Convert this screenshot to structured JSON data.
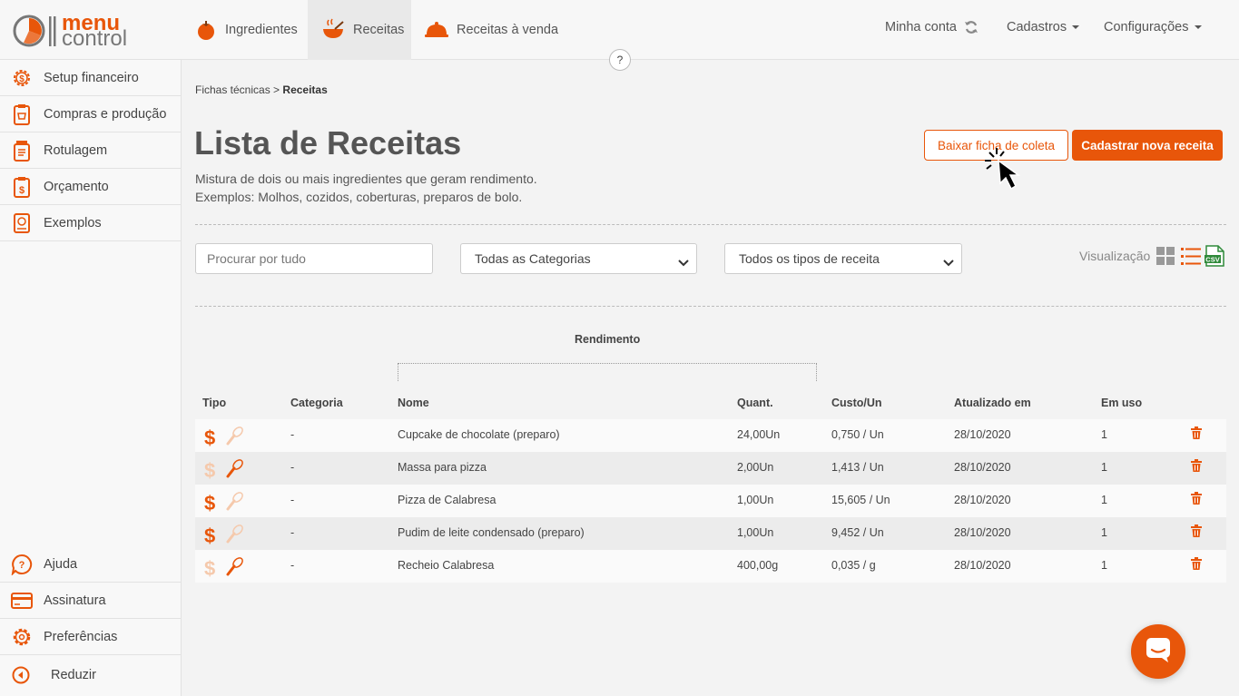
{
  "logo": {
    "line1": "menu",
    "line2": "control"
  },
  "nav": {
    "tabs": [
      {
        "label": "Ingredientes",
        "icon": "tomato-icon"
      },
      {
        "label": "Receitas",
        "icon": "bowl-icon"
      },
      {
        "label": "Receitas à venda",
        "icon": "cloche-icon"
      }
    ],
    "account": "Minha conta",
    "cadastros": "Cadastros",
    "config": "Configurações",
    "help": "?"
  },
  "sidebar": {
    "items": [
      {
        "label": "Setup financeiro"
      },
      {
        "label": "Compras e produção"
      },
      {
        "label": "Rotulagem"
      },
      {
        "label": "Orçamento"
      },
      {
        "label": "Exemplos"
      }
    ],
    "bottom": [
      {
        "label": "Ajuda"
      },
      {
        "label": "Assinatura"
      },
      {
        "label": "Preferências"
      },
      {
        "label": "Reduzir"
      }
    ]
  },
  "breadcrumb": {
    "parent": "Fichas técnicas",
    "sep": ">",
    "current": "Receitas"
  },
  "page": {
    "title": "Lista de Receitas",
    "desc1": "Mistura de dois ou mais ingredientes que geram rendimento.",
    "desc2": "Exemplos: Molhos, cozidos, coberturas, preparos de bolo."
  },
  "buttons": {
    "download": "Baixar ficha de coleta",
    "new": "Cadastrar nova receita"
  },
  "filters": {
    "search_placeholder": "Procurar por tudo",
    "category": "Todas as Categorias",
    "type": "Todos os tipos de receita",
    "view_label": "Visualização",
    "csv": "CSV"
  },
  "table": {
    "group_header": "Rendimento",
    "headers": [
      "Tipo",
      "Categoria",
      "Nome",
      "Quant.",
      "Custo/Un",
      "Atualizado em",
      "Em uso"
    ],
    "rows": [
      {
        "dollar_active": true,
        "whisk_active": false,
        "categoria": "-",
        "nome": "Cupcake de chocolate (preparo)",
        "quant": "24,00Un",
        "custo": "0,750 / Un",
        "data": "28/10/2020",
        "uso": "1"
      },
      {
        "dollar_active": false,
        "whisk_active": true,
        "categoria": "-",
        "nome": "Massa para pizza",
        "quant": "2,00Un",
        "custo": "1,413 / Un",
        "data": "28/10/2020",
        "uso": "1"
      },
      {
        "dollar_active": true,
        "whisk_active": false,
        "categoria": "-",
        "nome": "Pizza de Calabresa",
        "quant": "1,00Un",
        "custo": "15,605 / Un",
        "data": "28/10/2020",
        "uso": "1"
      },
      {
        "dollar_active": true,
        "whisk_active": false,
        "categoria": "-",
        "nome": "Pudim de leite condensado (preparo)",
        "quant": "1,00Un",
        "custo": "9,452 / Un",
        "data": "28/10/2020",
        "uso": "1"
      },
      {
        "dollar_active": false,
        "whisk_active": true,
        "categoria": "-",
        "nome": "Recheio Calabresa",
        "quant": "400,00g",
        "custo": "0,035 / g",
        "data": "28/10/2020",
        "uso": "1"
      }
    ]
  },
  "colors": {
    "accent": "#e8560a",
    "accent_light": "#f5c9ac"
  }
}
